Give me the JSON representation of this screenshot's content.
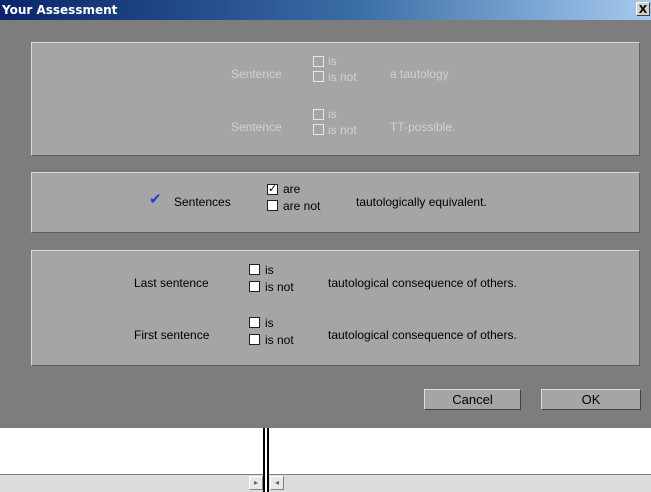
{
  "window": {
    "title": "Your Assessment",
    "close_glyph": "X"
  },
  "panel1": {
    "rows": [
      {
        "label": "Sentence",
        "opt1": "is",
        "opt2": "is not",
        "tail": "a tautology"
      },
      {
        "label": "Sentence",
        "opt1": "is",
        "opt2": "is not",
        "tail": "TT-possible."
      }
    ]
  },
  "panel2": {
    "check_glyph": "✔",
    "label": "Sentences",
    "opt1": "are",
    "opt2": "are not",
    "tail": "tautologically equivalent.",
    "opt1_checked": true
  },
  "panel3": {
    "rows": [
      {
        "label": "Last sentence",
        "opt1": "is",
        "opt2": "is not",
        "tail": "tautological consequence of others."
      },
      {
        "label": "First sentence",
        "opt1": "is",
        "opt2": "is not",
        "tail": "tautological consequence of others."
      }
    ]
  },
  "buttons": {
    "cancel": "Cancel",
    "ok": "OK"
  },
  "scrollbar": {
    "right_arrow": "▸",
    "left_arrow": "◂"
  },
  "colors": {
    "dialog_bg": "#7d7d7d",
    "panel_bg": "#a5a5a5",
    "tick": "#1a3de0",
    "title_start": "#0a246a"
  }
}
